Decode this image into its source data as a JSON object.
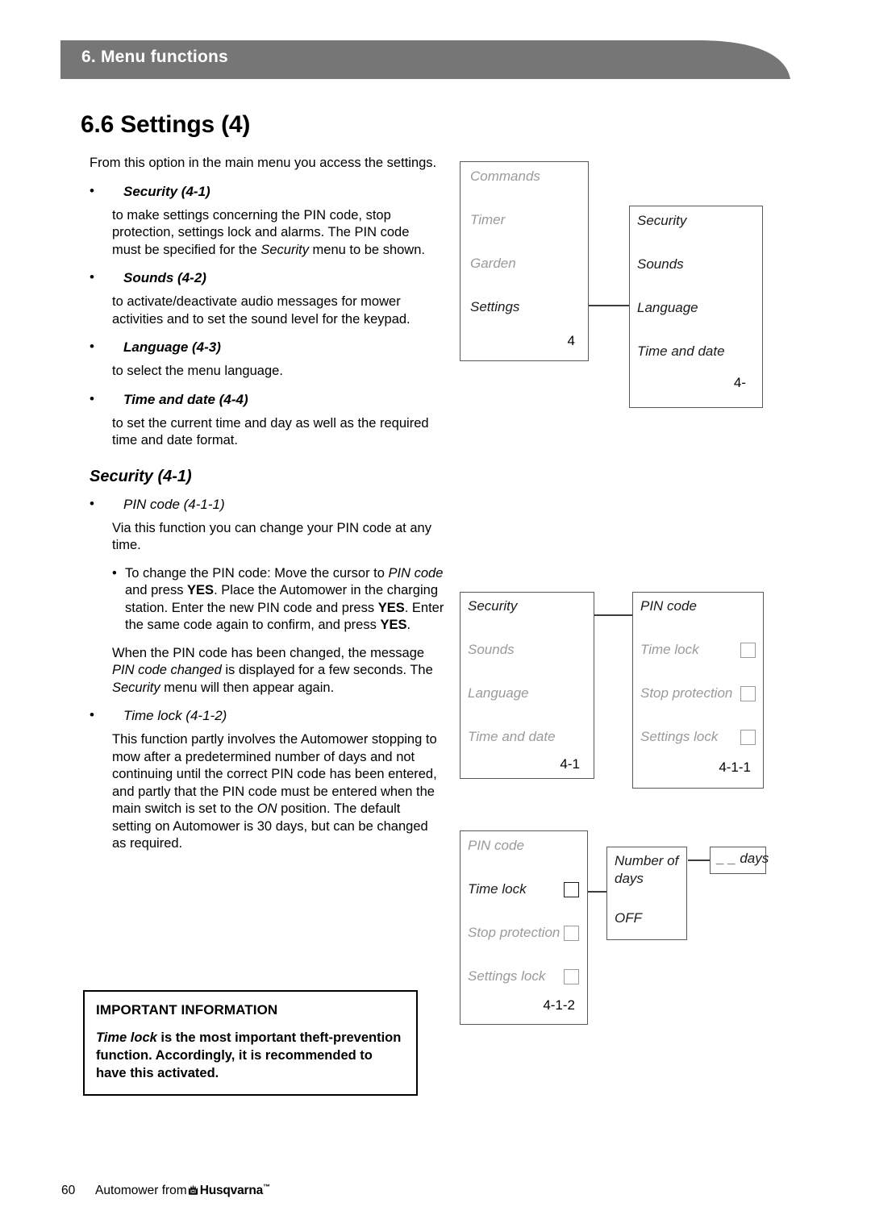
{
  "header": {
    "chapter_title": "6. Menu functions",
    "bar_color": "#767676"
  },
  "page_title": "6.6 Settings (4)",
  "body": {
    "intro": "From this option in the main menu you access the settings.",
    "bullets": [
      {
        "heading": "Security (4-1)",
        "text_parts": {
          "p1": "to make settings concerning the PIN code, stop protection, settings lock and alarms. The PIN code must be specified for the ",
          "em1": "Security",
          "p2": " menu to be shown."
        }
      },
      {
        "heading": "Sounds (4-2)",
        "text": "to activate/deactivate audio messages for mower activities and to set the sound level for the keypad."
      },
      {
        "heading": "Language (4-3)",
        "text": "to select the menu language."
      },
      {
        "heading": "Time and date (4-4)",
        "text": "to set the current time and day as well as the required time and date format."
      }
    ],
    "security_section": {
      "heading": "Security (4-1)",
      "pin_code": {
        "heading": "PIN code (4-1-1)",
        "intro": "Via this function you can change your PIN code at any time.",
        "change_steps": {
          "s1": "To change the PIN code: Move the cursor to ",
          "em1": "PIN code",
          "s2": " and press ",
          "b1": "YES",
          "s3": ". Place the Automower in the charging station. Enter the new PIN code and press ",
          "b2": "YES",
          "s4": ". Enter the same code again to confirm, and press ",
          "b3": "YES",
          "s5": "."
        },
        "changed_msg": {
          "t1": "When the PIN code has been changed, the message ",
          "em1": "PIN code changed",
          "t2": " is displayed for a few seconds. The ",
          "em2": "Security",
          "t3": " menu will then appear again."
        }
      },
      "time_lock": {
        "heading": "Time lock (4-1-2)",
        "text": {
          "t1": "This function partly involves the Automower stopping to mow after a predetermined number of days and not continuing until the correct PIN code has been entered, and partly that the PIN code must be entered when the main switch is set to the ",
          "em1": "ON",
          "t2": " position. The default setting on Automower is 30 days, but can be changed as required."
        }
      }
    }
  },
  "important_box": {
    "title": "IMPORTANT INFORMATION",
    "body": {
      "em1": "Time lock",
      "t1": " is the most important theft-prevention function. Accordingly, it is recommended to have this activated."
    }
  },
  "diagrams": [
    {
      "id": "diagram-settings",
      "boxes": [
        {
          "name": "main-menu-box",
          "code": "4",
          "items": [
            {
              "label": "Commands",
              "state": "dim"
            },
            {
              "label": "Timer",
              "state": "dim"
            },
            {
              "label": "Garden",
              "state": "dim"
            },
            {
              "label": "Settings",
              "state": "on"
            }
          ]
        },
        {
          "name": "settings-menu-box",
          "code": "4-",
          "items": [
            {
              "label": "Security",
              "state": "on"
            },
            {
              "label": "Sounds",
              "state": "on"
            },
            {
              "label": "Language",
              "state": "on"
            },
            {
              "label": "Time and date",
              "state": "on"
            }
          ]
        }
      ]
    },
    {
      "id": "diagram-security",
      "boxes": [
        {
          "name": "settings-menu-box",
          "code": "4-1",
          "items": [
            {
              "label": "Security",
              "state": "on"
            },
            {
              "label": "Sounds",
              "state": "dim"
            },
            {
              "label": "Language",
              "state": "dim"
            },
            {
              "label": "Time and date",
              "state": "dim"
            }
          ]
        },
        {
          "name": "security-menu-box",
          "code": "4-1-1",
          "items": [
            {
              "label": "PIN code",
              "state": "on",
              "checkbox": false
            },
            {
              "label": "Time lock",
              "state": "dim",
              "checkbox": true,
              "checkbox_state": "dim"
            },
            {
              "label": "Stop protection",
              "state": "dim",
              "checkbox": true,
              "checkbox_state": "dim"
            },
            {
              "label": "Settings lock",
              "state": "dim",
              "checkbox": true,
              "checkbox_state": "dim"
            }
          ]
        }
      ]
    },
    {
      "id": "diagram-time-lock",
      "boxes": [
        {
          "name": "security-menu-box",
          "code": "4-1-2",
          "items": [
            {
              "label": "PIN code",
              "state": "dim",
              "checkbox": false
            },
            {
              "label": "Time lock",
              "state": "on",
              "checkbox": true,
              "checkbox_state": "on"
            },
            {
              "label": "Stop protection",
              "state": "dim",
              "checkbox": true,
              "checkbox_state": "dim"
            },
            {
              "label": "Settings lock",
              "state": "dim",
              "checkbox": true,
              "checkbox_state": "dim"
            }
          ]
        },
        {
          "name": "number-of-days-box",
          "items": [
            {
              "label": "Number of days",
              "state": "on"
            },
            {
              "label": "OFF",
              "state": "on"
            }
          ]
        },
        {
          "name": "days-value-box",
          "items": [
            {
              "label": "_ _ days",
              "state": "on"
            }
          ]
        }
      ]
    }
  ],
  "footer": {
    "page_number": "60",
    "text": "Automower from",
    "brand": "Husqvarna",
    "tm": "™"
  }
}
